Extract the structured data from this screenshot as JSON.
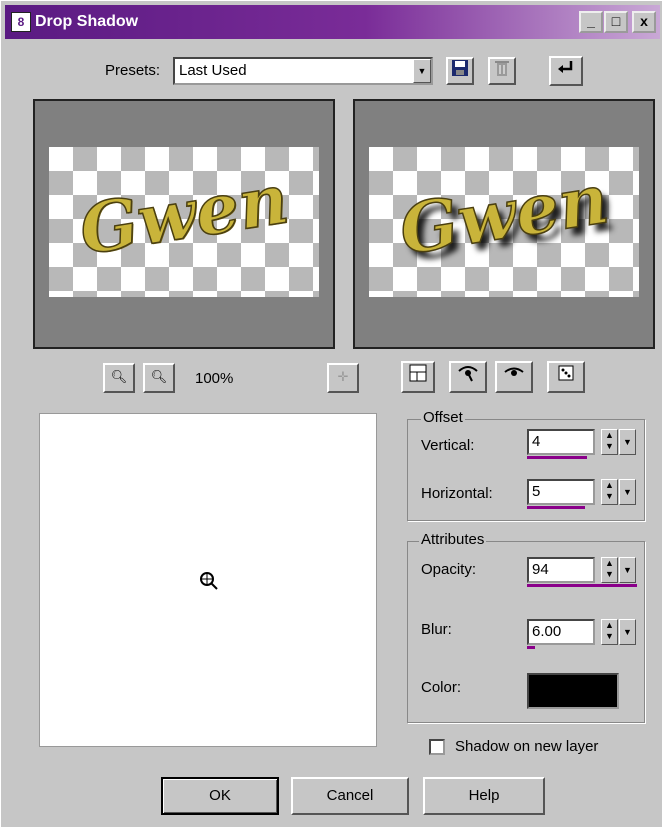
{
  "window": {
    "title": "Drop Shadow",
    "app_icon_text": "8",
    "minimize": "_",
    "maximize": "□",
    "close": "x"
  },
  "presets": {
    "label": "Presets:",
    "value": "Last Used"
  },
  "preview": {
    "text": "Gwen",
    "zoom": "100%"
  },
  "offset": {
    "title": "Offset",
    "vertical_label": "Vertical:",
    "vertical_value": "4",
    "horizontal_label": "Horizontal:",
    "horizontal_value": "5"
  },
  "attributes": {
    "title": "Attributes",
    "opacity_label": "Opacity:",
    "opacity_value": "94",
    "blur_label": "Blur:",
    "blur_value": "6.00",
    "color_label": "Color:",
    "color_value": "#000000"
  },
  "checkbox": {
    "label": "Shadow on new layer",
    "checked": false
  },
  "buttons": {
    "ok": "OK",
    "cancel": "Cancel",
    "help": "Help"
  }
}
